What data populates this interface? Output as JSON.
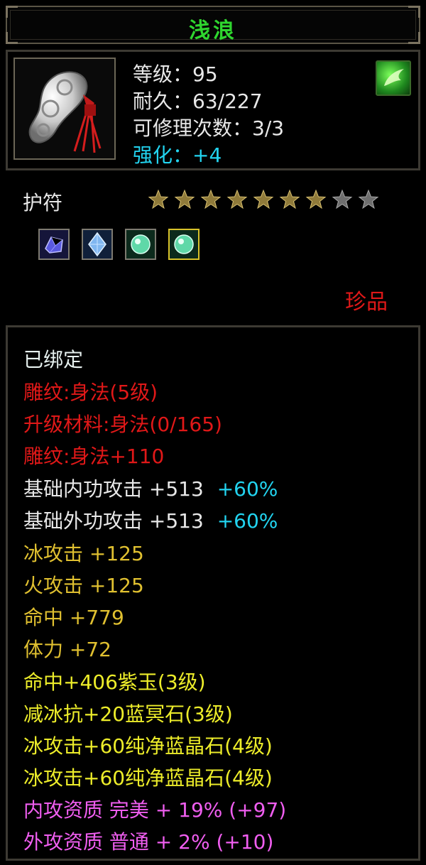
{
  "title": "浅浪",
  "item": {
    "level": "等级：95",
    "durability": "耐久：63/227",
    "repair": "可修理次数：3/3",
    "enhance": "强化：+4",
    "icon": "jade-amulet-icon",
    "badge_icon": "green-flame-badge-icon"
  },
  "category": "护符",
  "stars": {
    "filled": 7,
    "total": 9
  },
  "gems": [
    "purple-gem-icon",
    "blue-crystal-icon",
    "green-jade-icon",
    "green-jade-icon"
  ],
  "rarity": "珍品",
  "attributes": {
    "bound": "已绑定",
    "carve1": "雕纹:身法(5级)",
    "upgrade": "升级材料:身法(0/165)",
    "carve2": "雕纹:身法+110",
    "inner_atk": "基础内功攻击 +513",
    "inner_atk_pct": "+60%",
    "outer_atk": "基础外功攻击 +513",
    "outer_atk_pct": "+60%",
    "ice_atk": "冰攻击 +125",
    "fire_atk": "火攻击 +125",
    "hit": "命中 +779",
    "stamina": "体力 +72",
    "gem1": "命中+406紫玉(3级)",
    "gem2": "减冰抗+20蓝冥石(3级)",
    "gem3": "冰攻击+60纯净蓝晶石(4级)",
    "gem4": "冰攻击+60纯净蓝晶石(4级)",
    "inner_quality": "内攻资质 完美 + 19% (+97)",
    "outer_quality": "外攻资质 普通 + 2% (+10)"
  },
  "colors": {
    "title": "#2fd62f",
    "cyan": "#22d4f0",
    "red": "#e01818",
    "gold": "#e0c030",
    "yellow": "#eded2a",
    "pink": "#f05ef0"
  }
}
